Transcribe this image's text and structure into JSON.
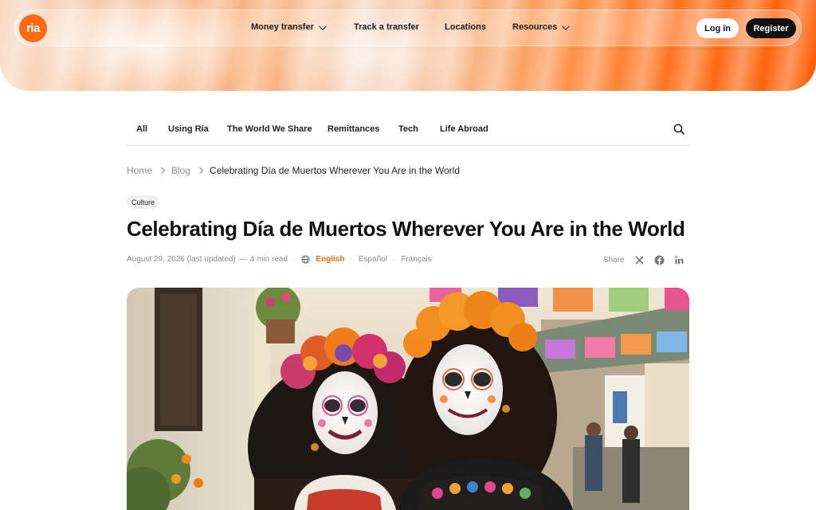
{
  "header": {
    "logo_text": "ria",
    "nav": [
      {
        "label": "Money transfer",
        "has_dropdown": true
      },
      {
        "label": "Track a transfer",
        "has_dropdown": false
      },
      {
        "label": "Locations",
        "has_dropdown": false
      },
      {
        "label": "Resources",
        "has_dropdown": true
      }
    ],
    "login_label": "Log in",
    "register_label": "Register",
    "brand_color": "#ff6a13"
  },
  "categories": [
    "All",
    "Using Ria",
    "The World We Share",
    "Remittances",
    "Tech",
    "Life Abroad"
  ],
  "search_icon": "search-icon",
  "breadcrumb": {
    "home": "Home",
    "blog": "Blog",
    "current": "Celebrating Día de Muertos Wherever You Are in the World"
  },
  "article": {
    "tag": "Culture",
    "title": "Celebrating Día de Muertos Wherever You Are in the World",
    "date": "August 29, 2026 (last updated)",
    "separator": "—",
    "read_time": "4 min read",
    "languages": {
      "active": "English",
      "others": [
        "Español",
        "Français"
      ]
    },
    "share_label": "Share",
    "share_icons": [
      "x-icon",
      "facebook-icon",
      "linkedin-icon"
    ]
  }
}
